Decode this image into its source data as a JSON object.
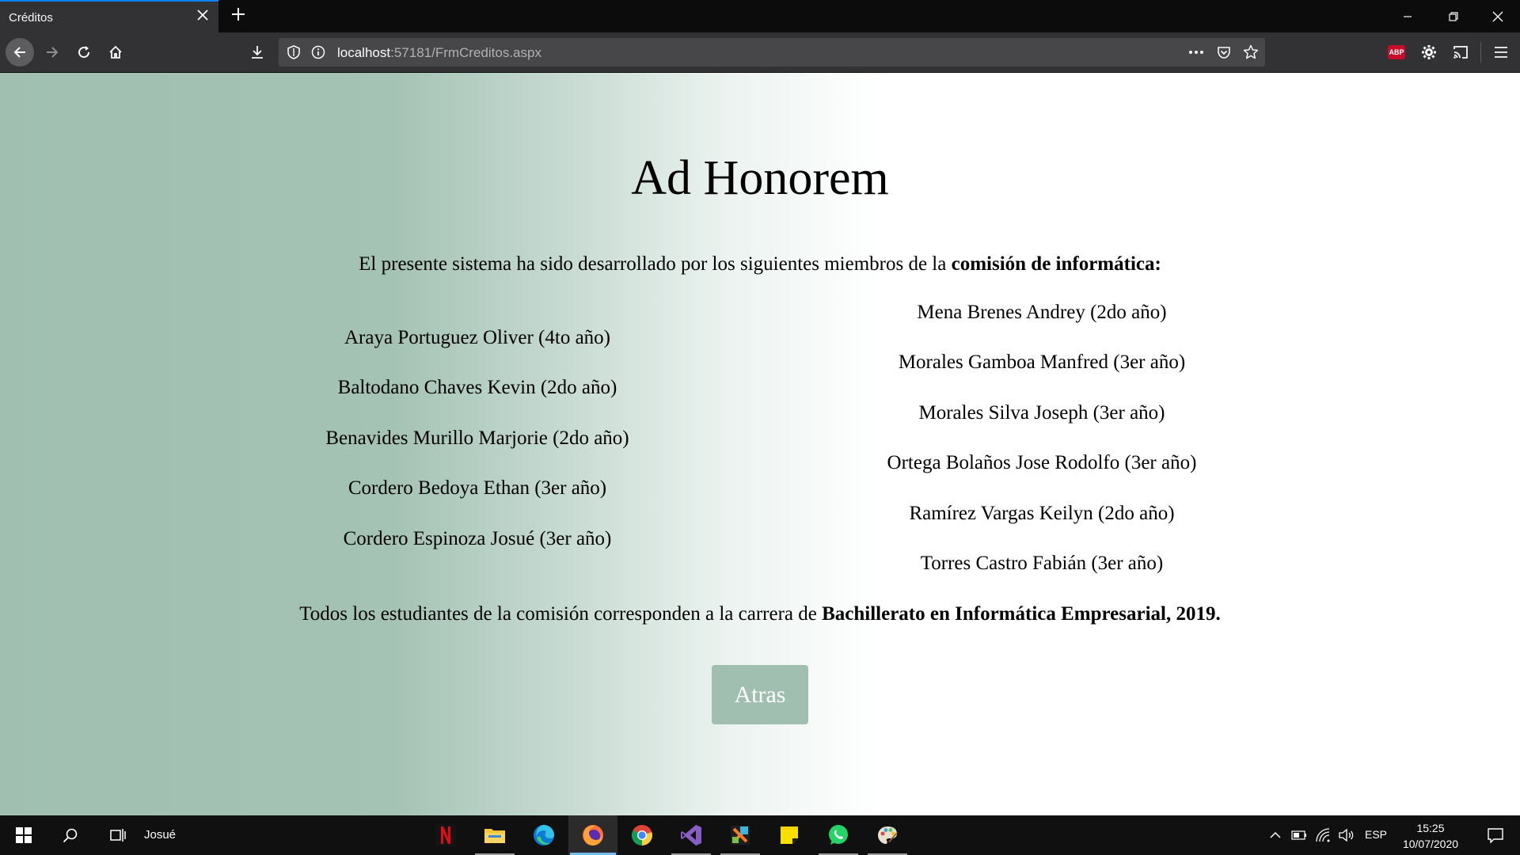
{
  "browser": {
    "tab_title": "Créditos",
    "url_host": "localhost",
    "url_rest": ":57181/FrmCreditos.aspx",
    "extension_badge": "ABP"
  },
  "page": {
    "heading": "Ad Honorem",
    "intro_text": "El presente sistema ha sido desarrollado por los siguientes miembros de la ",
    "intro_bold": "comisión de informática:",
    "members_left": [
      "Araya Portuguez Oliver (4to año)",
      "Baltodano Chaves Kevin (2do año)",
      "Benavides Murillo Marjorie (2do año)",
      "Cordero Bedoya Ethan (3er año)",
      "Cordero Espinoza Josué (3er año)"
    ],
    "members_right": [
      "Mena Brenes Andrey (2do año)",
      "Morales Gamboa Manfred (3er año)",
      "Morales Silva Joseph (3er año)",
      "Ortega Bolaños Jose Rodolfo (3er año)",
      "Ramírez Vargas Keilyn (2do año)",
      "Torres Castro Fabián (3er año)"
    ],
    "footer_text": "Todos los estudiantes de la comisión corresponden a la carrera de ",
    "footer_bold": "Bachillerato en Informática Empresarial, 2019.",
    "back_button": "Atras",
    "colors": {
      "gradient_start": "#a0bfb1",
      "button_bg": "#a0bfb1"
    }
  },
  "taskbar": {
    "user_label": "Josué",
    "language": "ESP",
    "time": "15:25",
    "date": "10/07/2020",
    "pinned_apps": [
      "netflix-icon",
      "file-explorer-icon",
      "edge-icon",
      "firefox-icon",
      "chrome-icon",
      "visual-studio-icon",
      "xampp-icon",
      "sticky-notes-icon",
      "whatsapp-icon",
      "paint-icon"
    ]
  }
}
